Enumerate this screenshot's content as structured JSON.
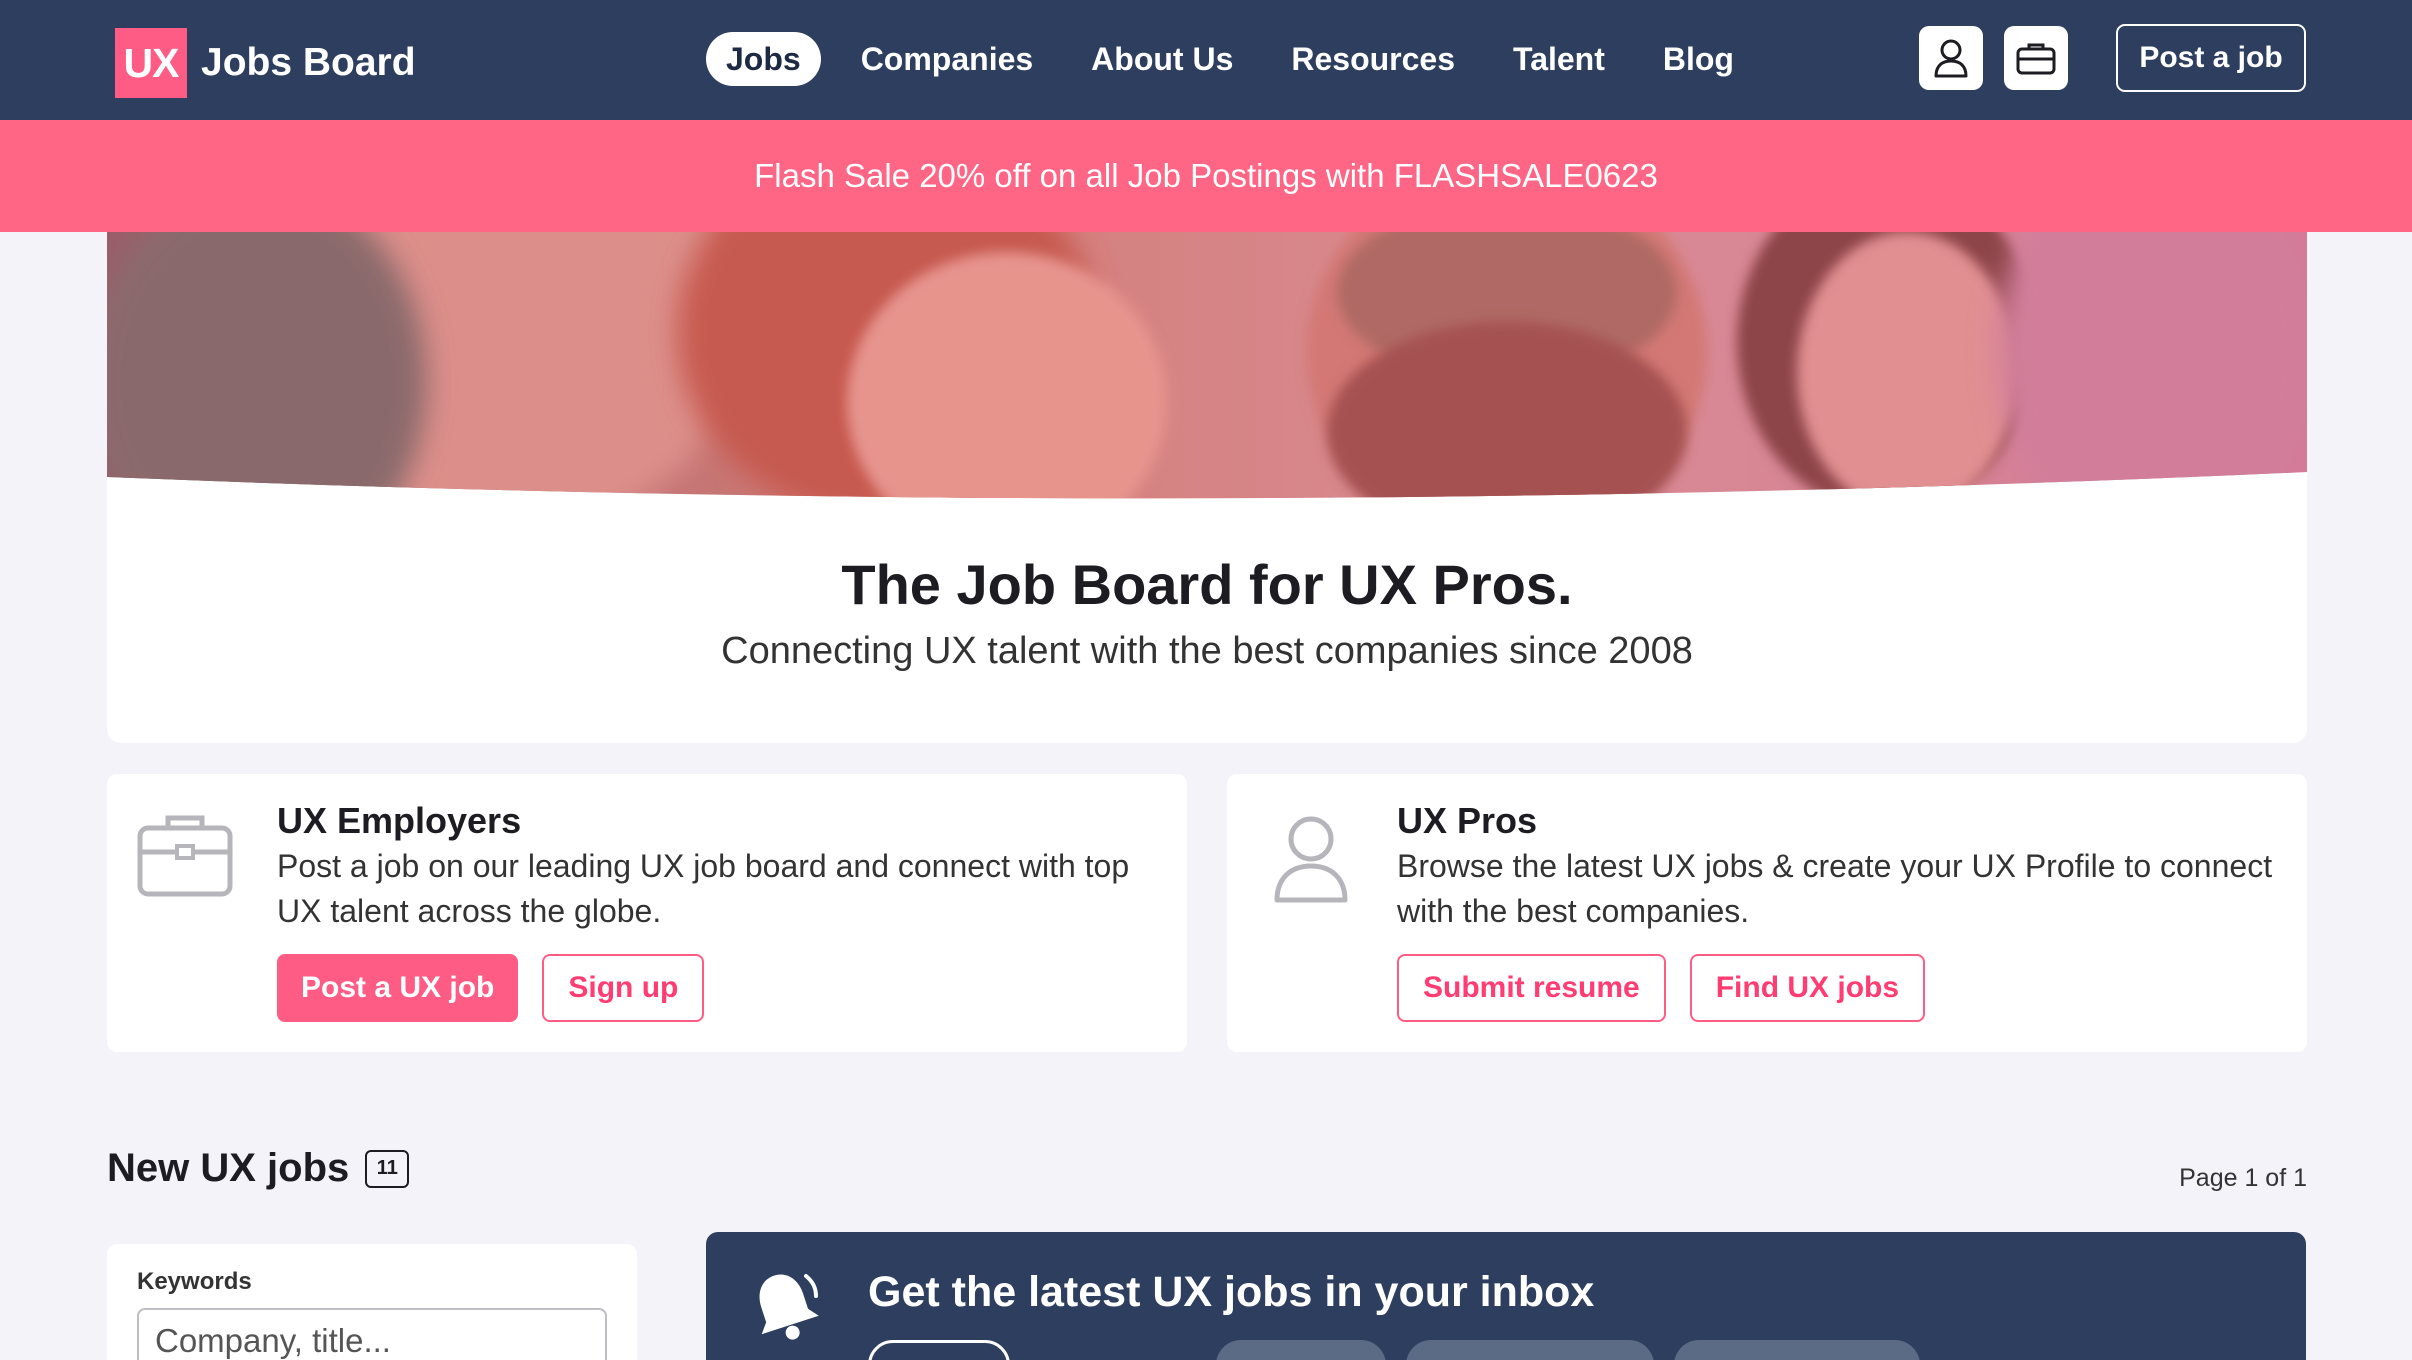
{
  "brand": {
    "badge": "UX",
    "name": "Jobs Board"
  },
  "nav": {
    "links": [
      {
        "label": "Jobs",
        "active": true
      },
      {
        "label": "Companies",
        "active": false
      },
      {
        "label": "About Us",
        "active": false
      },
      {
        "label": "Resources",
        "active": false
      },
      {
        "label": "Talent",
        "active": false
      },
      {
        "label": "Blog",
        "active": false
      }
    ],
    "account_icon": "user-icon",
    "jobs_icon": "briefcase-icon",
    "post_job_label": "Post a job"
  },
  "promo": {
    "text": "Flash Sale 20% off on all Job Postings with FLASHSALE0623"
  },
  "hero": {
    "title": "The Job Board for UX Pros.",
    "subtitle": "Connecting UX talent with the best companies since 2008"
  },
  "employers": {
    "icon": "briefcase-icon",
    "title": "UX Employers",
    "text": "Post a job on our leading UX job board and connect with top UX talent across the globe.",
    "primary_label": "Post a UX job",
    "secondary_label": "Sign up"
  },
  "pros": {
    "icon": "user-icon",
    "title": "UX Pros",
    "text": "Browse the latest UX jobs & create your UX Profile to connect with the best companies.",
    "primary_label": "Submit resume",
    "secondary_label": "Find UX jobs"
  },
  "jobs": {
    "title": "New UX jobs",
    "count": "11",
    "page": "Page 1 of 1"
  },
  "filter": {
    "keywords_label": "Keywords",
    "keywords_placeholder": "Company, title..."
  },
  "newsletter": {
    "icon": "bell-icon",
    "title": "Get the latest UX jobs in your inbox"
  },
  "colors": {
    "navy": "#2d3e5e",
    "brand_pink": "#ff5c85",
    "promo_pink": "#ff6685",
    "page_bg": "#f4f3fa"
  }
}
